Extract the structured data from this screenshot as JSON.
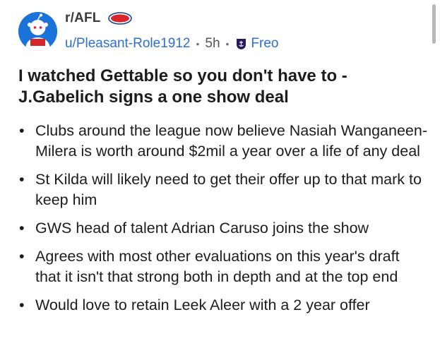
{
  "post": {
    "subreddit": "r/AFL",
    "subreddit_badge": "AFL",
    "author": "u/Pleasant-Role1912",
    "separator": "•",
    "time": "5h",
    "flair": "Freo",
    "title": "I watched Gettable so you don't have to - J.Gabelich signs a one show deal",
    "bullet_symbol": "•",
    "bullets": [
      "Clubs around the league now believe Nasiah Wanganeen-Milera is worth around $2mil a year over a life of any deal",
      "St Kilda will likely need to get their offer up to that mark to keep him",
      "GWS head of talent Adrian Caruso joins the show",
      "Agrees with most other evaluations on this year's draft that it isn't that strong both in depth and at the top end",
      "Would love to retain Leek Aleer with a 2 year offer"
    ]
  },
  "colors": {
    "link": "#2b6fd6",
    "title": "#1c1c1c",
    "avatar_bg": "#1a73d9",
    "afl_badge_red": "#d7262b",
    "afl_badge_blue": "#0b3b8c",
    "freo_purple": "#2a1a5e"
  },
  "icons": {
    "avatar": "snoo-footballer-icon",
    "badge": "afl-logo-icon",
    "flair": "fremantle-anchor-icon"
  }
}
